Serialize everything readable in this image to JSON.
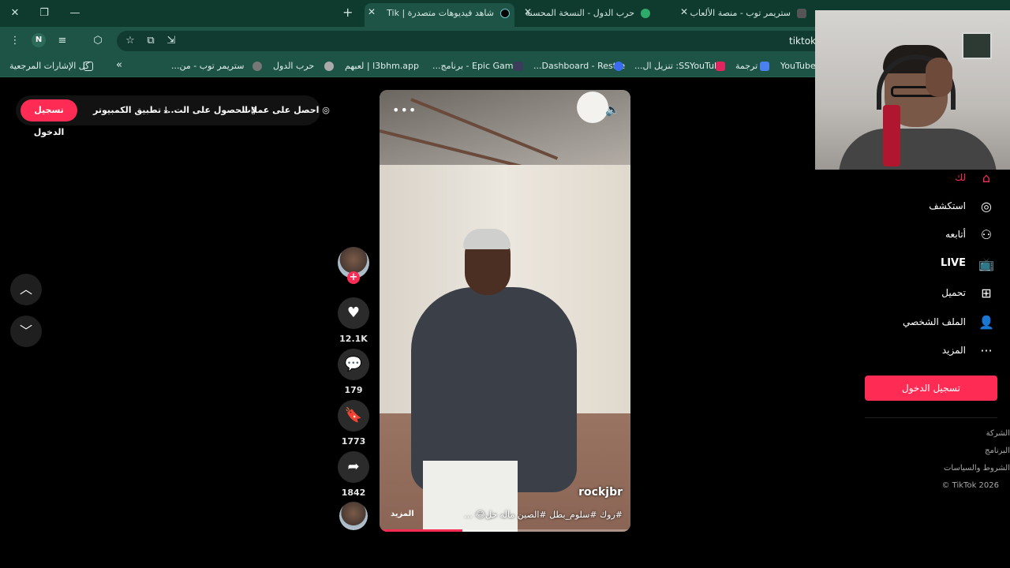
{
  "browser": {
    "tabs": [
      {
        "title": "ستريمر توب - منصة الألعاب",
        "active": false
      },
      {
        "title": "حرب الدول - النسخة المحسنة",
        "active": false
      },
      {
        "title": "شاهد فيديوهات متصدرة | Tik",
        "active": true
      }
    ],
    "url": "tiktok",
    "profile_initial": "N",
    "bookmarks": {
      "all_label": "كل الإشارات المرجعية",
      "overflow": "»",
      "items": [
        "ستريمر توب - من...",
        "حرب الدول",
        "l3bhm.app | لعبهم",
        "Epic Games - برنامج...",
        "Dashboard - Restre...",
        "SSYouTube: تنزيل ال...",
        "ترجمة",
        "YouTube"
      ]
    }
  },
  "topbar": {
    "login": "تسجيل الدخول",
    "desktop_app": "تطبيق الكمبيوتر",
    "get_app": "الحصول على الت...",
    "get_coins": "احصل على عملات"
  },
  "video": {
    "username": "rockjbr",
    "caption": "#روك #سلوم_بطل #الصين ماله حل😂 ...",
    "more_label": "المزيد",
    "progress": 0.33
  },
  "actions": {
    "likes": "12.1K",
    "comments": "179",
    "saves": "1773",
    "shares": "1842"
  },
  "sidebar": {
    "items": [
      {
        "label": "لك",
        "icon": "home-icon",
        "active": true
      },
      {
        "label": "استكشف",
        "icon": "compass-icon"
      },
      {
        "label": "أتابعه",
        "icon": "following-icon"
      },
      {
        "label": "LIVE",
        "icon": "live-icon"
      },
      {
        "label": "تحميل",
        "icon": "upload-icon"
      },
      {
        "label": "الملف الشخصي",
        "icon": "profile-icon"
      },
      {
        "label": "المزيد",
        "icon": "more-icon"
      }
    ],
    "login": "تسجيل الدخول",
    "footer": [
      "الشركة",
      "البرنامج",
      "الشروط والسياسات",
      "© TikTok 2026"
    ]
  },
  "colors": {
    "accent": "#fe2c55",
    "chrome": "#1d5446",
    "tabstrip": "#0f3b2f"
  }
}
